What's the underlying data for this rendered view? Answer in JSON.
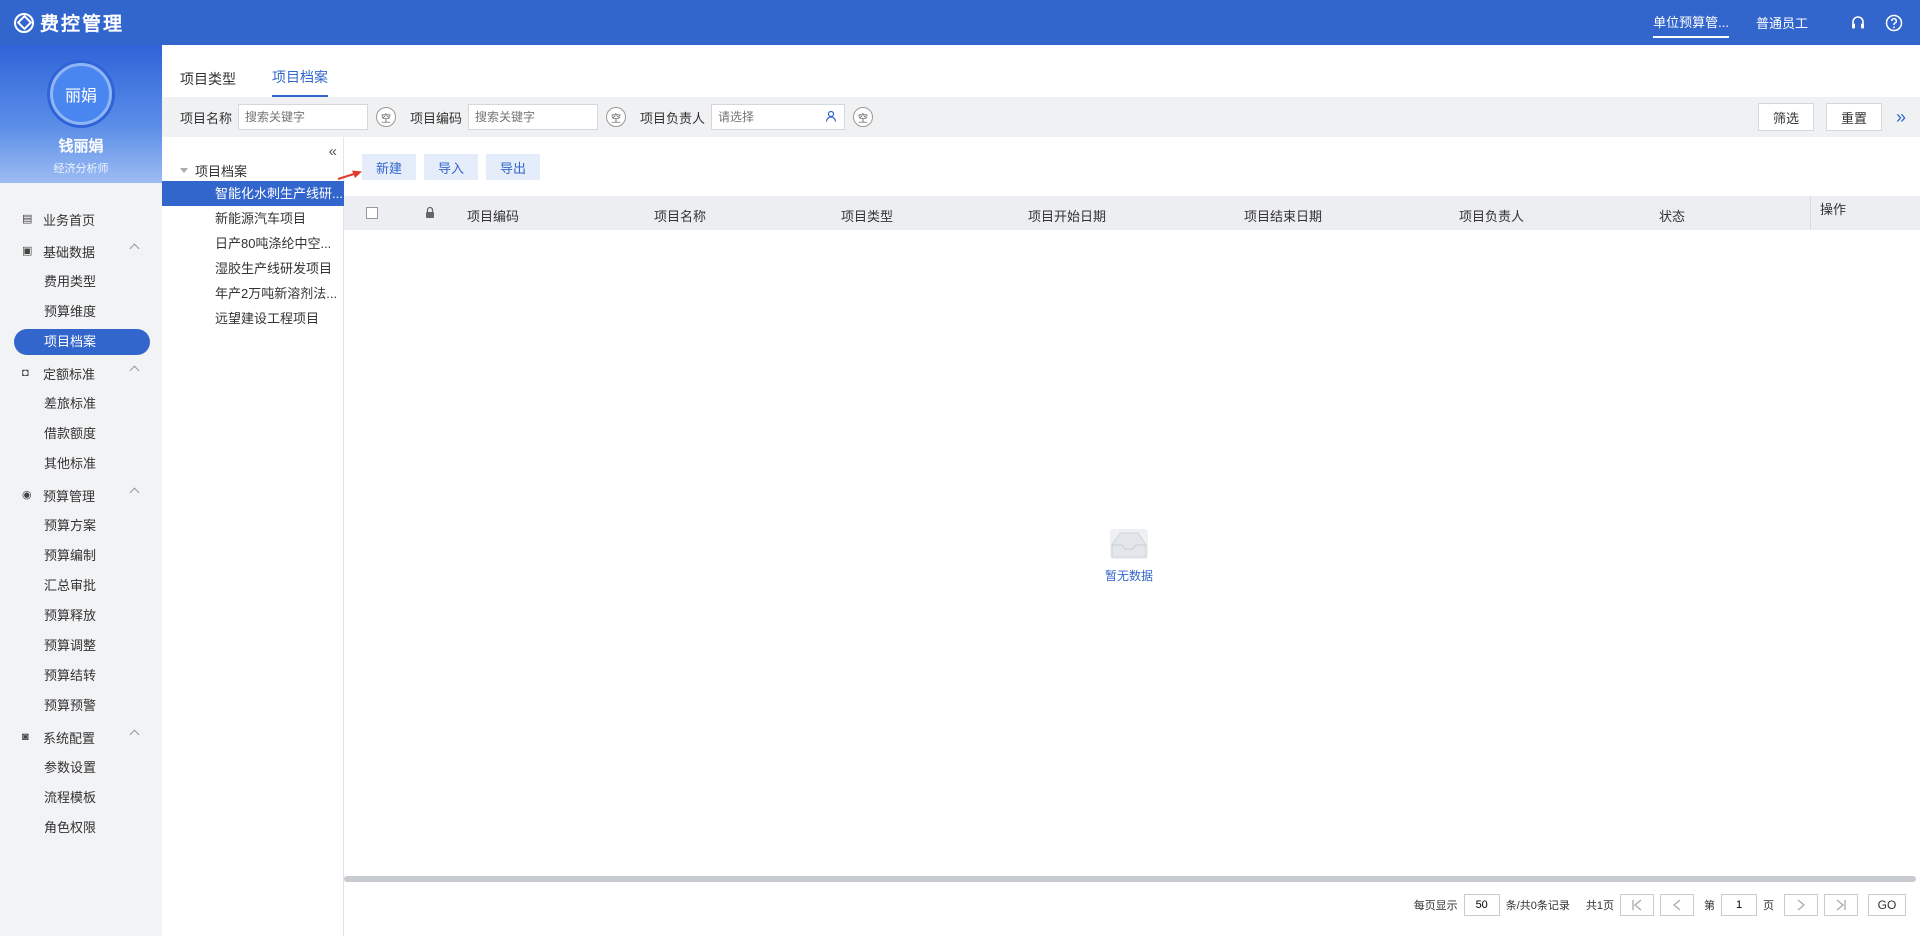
{
  "app": {
    "title": "费控管理"
  },
  "header": {
    "role": "单位预算管...",
    "user": "普通员工",
    "support_icon": "headset-icon",
    "help_icon": "help-icon"
  },
  "profile": {
    "avatar_text": "丽娟",
    "name": "钱丽娟",
    "title": "经济分析师"
  },
  "nav": {
    "home": "业务首页",
    "basic": {
      "label": "基础数据",
      "items": [
        "费用类型",
        "预算维度",
        "项目档案"
      ]
    },
    "quota": {
      "label": "定额标准",
      "items": [
        "差旅标准",
        "借款额度",
        "其他标准"
      ]
    },
    "budget": {
      "label": "预算管理",
      "items": [
        "预算方案",
        "预算编制",
        "汇总审批",
        "预算释放",
        "预算调整",
        "预算结转",
        "预算预警"
      ]
    },
    "config": {
      "label": "系统配置",
      "items": [
        "参数设置",
        "流程模板",
        "角色权限"
      ]
    }
  },
  "tabs": [
    "项目类型",
    "项目档案"
  ],
  "filter": {
    "name_label": "项目名称",
    "name_placeholder": "搜索关键字",
    "code_label": "项目编码",
    "code_placeholder": "搜索关键字",
    "owner_label": "项目负责人",
    "owner_placeholder": "请选择",
    "clear": "空",
    "filter_button": "筛选",
    "reset_button": "重置",
    "expand": "»"
  },
  "tree": {
    "collapse": "«",
    "root": "项目档案",
    "nodes": [
      "智能化水刺生产线研...",
      "新能源汽车项目",
      "日产80吨涤纶中空...",
      "湿胶生产线研发项目",
      "年产2万吨新溶剂法...",
      "远望建设工程项目"
    ]
  },
  "toolbar": {
    "new": "新建",
    "import": "导入",
    "export": "导出"
  },
  "table": {
    "columns": [
      "项目编码",
      "项目名称",
      "项目类型",
      "项目开始日期",
      "项目结束日期",
      "项目负责人",
      "状态",
      "操作"
    ],
    "empty_text": "暂无数据"
  },
  "pager": {
    "per_page_label": "每页显示",
    "per_page": "50",
    "records": "条/共0条记录",
    "total_pages": "共1页",
    "page_prefix": "第",
    "page": "1",
    "page_suffix": "页",
    "go": "GO"
  },
  "colors": {
    "primary": "#3366cc",
    "sidebar_bg": "#f2f3f5",
    "filter_bg": "#f0f1f3",
    "button_bg": "#e5edfb",
    "arrow": "#e23b2e"
  }
}
